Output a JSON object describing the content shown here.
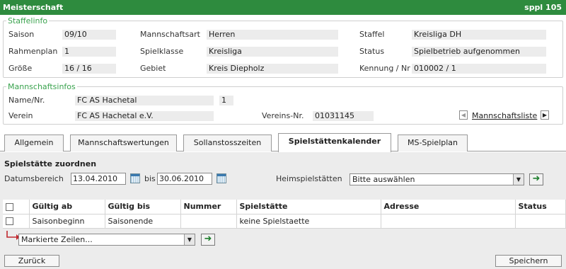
{
  "titlebar": {
    "title": "Meisterschaft",
    "right": "sppl 105"
  },
  "staffelinfo": {
    "legend": "Staffelinfo",
    "col1": [
      {
        "label": "Saison",
        "value": "09/10"
      },
      {
        "label": "Rahmenplan",
        "value": "1"
      },
      {
        "label": "Größe",
        "value": "16 / 16"
      }
    ],
    "col2": [
      {
        "label": "Mannschaftsart",
        "value": "Herren"
      },
      {
        "label": "Spielklasse",
        "value": "Kreisliga"
      },
      {
        "label": "Gebiet",
        "value": "Kreis Diepholz"
      }
    ],
    "col3": [
      {
        "label": "Staffel",
        "value": "Kreisliga DH"
      },
      {
        "label": "Status",
        "value": "Spielbetrieb aufgenommen"
      },
      {
        "label": "Kennung / Nr",
        "value": "010002 / 1"
      }
    ]
  },
  "mannschaftsinfos": {
    "legend": "Mannschaftsinfos",
    "name_label": "Name/Nr.",
    "name_value": "FC AS Hachetal",
    "nr_value": "1",
    "verein_label": "Verein",
    "verein_value": "FC AS Hachetal e.V.",
    "vereinsnr_label": "Vereins-Nr.",
    "vereinsnr_value": "01031145",
    "list_link": "Mannschaftsliste"
  },
  "tabs": [
    {
      "label": "Allgemein",
      "active": false
    },
    {
      "label": "Mannschaftswertungen",
      "active": false
    },
    {
      "label": "Sollanstosszeiten",
      "active": false
    },
    {
      "label": "Spielstättenkalender",
      "active": true
    },
    {
      "label": "MS-Spielplan",
      "active": false
    }
  ],
  "form": {
    "section_title": "Spielstätte zuordnen",
    "date_label": "Datumsbereich",
    "date_from": "13.04.2010",
    "bis_label": "bis",
    "date_to": "30.06.2010",
    "venue_label": "Heimspielstätten",
    "venue_select": "Bitte auswählen"
  },
  "table": {
    "headers": [
      "Gültig ab",
      "Gültig bis",
      "Nummer",
      "Spielstätte",
      "Adresse",
      "Status"
    ],
    "rows": [
      [
        "Saisonbeginn",
        "Saisonende",
        "",
        "keine Spielstaette",
        "",
        ""
      ]
    ]
  },
  "bulk": {
    "select": "Markierte Zeilen..."
  },
  "buttons": {
    "back": "Zurück",
    "save": "Speichern"
  },
  "colors": {
    "header_green": "#2e8b3e",
    "legend_green": "#3aa34e",
    "arrow_red": "#c0282e"
  }
}
